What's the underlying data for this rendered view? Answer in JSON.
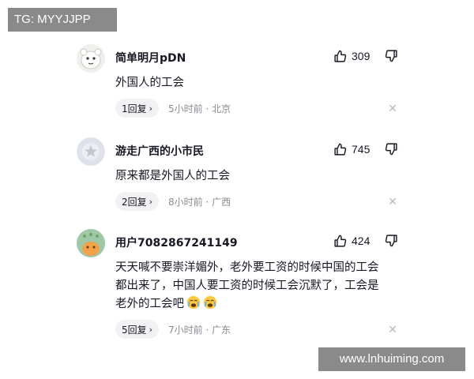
{
  "watermarks": {
    "top": "TG: MYYJJPP",
    "bottom": "www.lnhuiming.com"
  },
  "colors": {
    "text_primary": "#161823",
    "text_secondary": "#8a8b91",
    "pill_bg": "#f2f2f4",
    "watermark_bg": "#8a8a8a"
  },
  "comments": [
    {
      "username": "简单明月pDN",
      "avatar_icon": "cartoon-avatar-icon",
      "likes": "309",
      "content": "外国人的工会",
      "reply_label": "1回复",
      "time_location": "5小时前 · 北京"
    },
    {
      "username": "游走广西的小市民",
      "avatar_icon": "default-avatar-icon",
      "likes": "745",
      "content": "原来都是外国人的工会",
      "reply_label": "2回复",
      "time_location": "8小时前 · 广西"
    },
    {
      "username": "用户7082867241149",
      "avatar_icon": "cartoon-avatar-icon",
      "likes": "424",
      "content_lines": [
        "天天喊不要崇洋媚外，老外要工资的时候中国的工会",
        "都出来了，中国人要工资的时候工会沉默了，工会是",
        "老外的工会吧"
      ],
      "emojis": [
        "crying-emoji",
        "crying-emoji"
      ],
      "reply_label": "5回复",
      "time_location": "7小时前 · 广东"
    }
  ]
}
